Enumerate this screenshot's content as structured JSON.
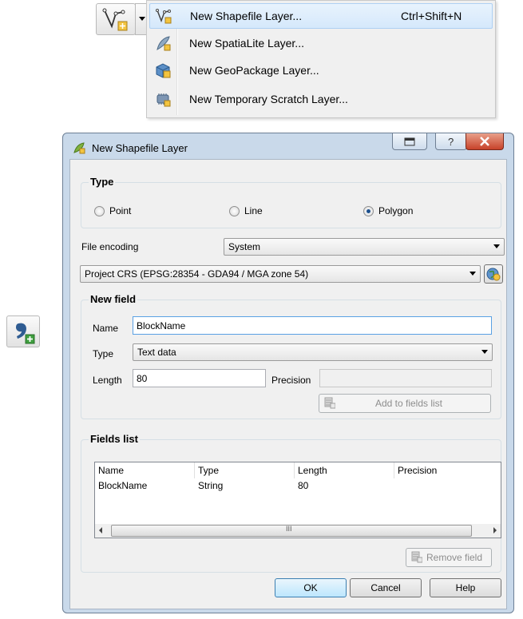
{
  "menu": {
    "items": [
      {
        "label": "New Shapefile Layer...",
        "shortcut": "Ctrl+Shift+N",
        "icon": "shapefile-icon"
      },
      {
        "label": "New SpatiaLite Layer...",
        "shortcut": "",
        "icon": "feather-icon"
      },
      {
        "label": "New GeoPackage Layer...",
        "shortcut": "",
        "icon": "geopackage-icon"
      },
      {
        "label": "New Temporary Scratch Layer...",
        "shortcut": "",
        "icon": "scratch-layer-icon"
      }
    ]
  },
  "dialog": {
    "title": "New Shapefile Layer",
    "type_group": {
      "title": "Type",
      "options": [
        "Point",
        "Line",
        "Polygon"
      ],
      "selected": "Polygon"
    },
    "file_encoding_label": "File encoding",
    "file_encoding_value": "System",
    "crs_value": "Project CRS (EPSG:28354 - GDA94 / MGA zone 54)",
    "new_field": {
      "title": "New field",
      "name_label": "Name",
      "name_value": "BlockName",
      "type_label": "Type",
      "type_value": "Text data",
      "length_label": "Length",
      "length_value": "80",
      "precision_label": "Precision",
      "precision_value": "",
      "add_button": "Add to fields list"
    },
    "fields_list": {
      "title": "Fields list",
      "columns": [
        "Name",
        "Type",
        "Length",
        "Precision"
      ],
      "rows": [
        [
          "BlockName",
          "String",
          "80",
          ""
        ]
      ],
      "remove_button": "Remove field"
    },
    "buttons": {
      "ok": "OK",
      "cancel": "Cancel",
      "help": "Help"
    },
    "scroll_thumb_glyph": "III"
  },
  "colors": {
    "accent": "#3c7fb1",
    "highlight": "#d5e8fb",
    "title_bar": "#c9d9ea",
    "close": "#c7432a"
  }
}
